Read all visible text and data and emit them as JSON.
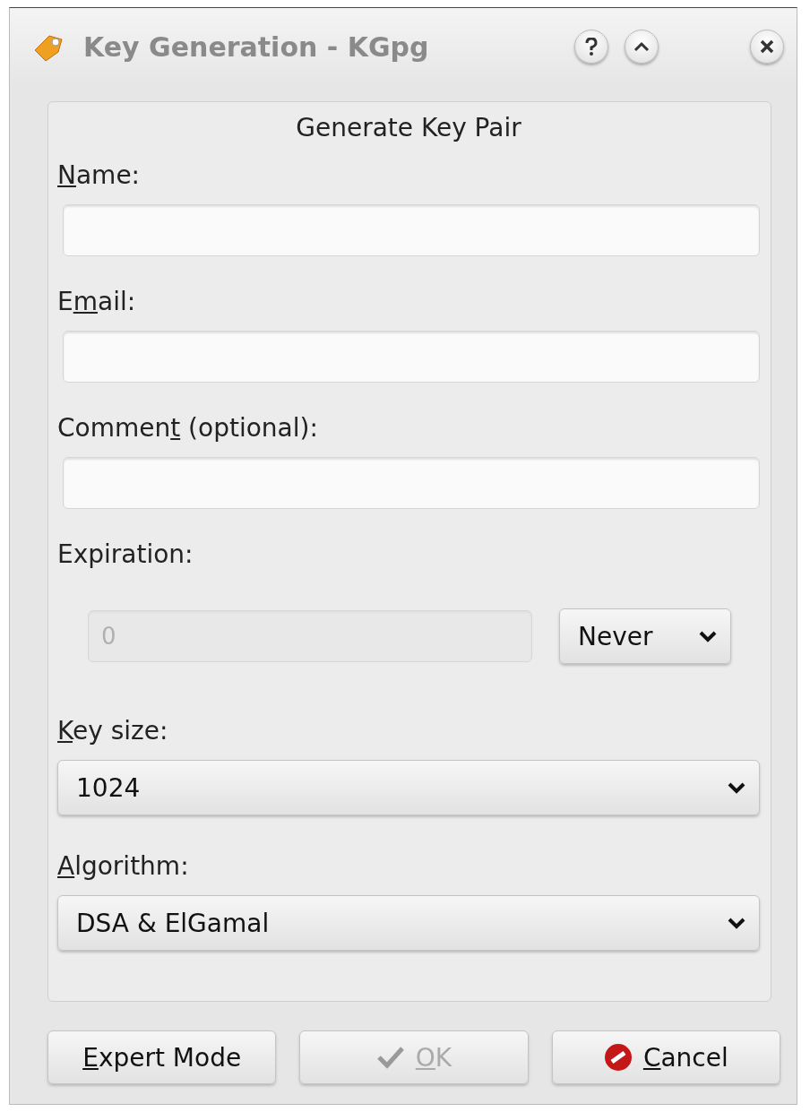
{
  "window": {
    "title": "Key Generation - KGpg"
  },
  "group": {
    "title": "Generate Key Pair"
  },
  "fields": [
    {
      "label": {
        "key": "N",
        "after": "ame:"
      }
    },
    {
      "label": {
        "before": "E",
        "key": "m",
        "after": "ail:"
      }
    },
    {
      "label": {
        "before": "Commen",
        "key": "t",
        "after": " (optional):"
      }
    }
  ],
  "expiration": {
    "label": {
      "before": "Expiration:"
    },
    "field": {
      "value": "0",
      "disabled": true
    },
    "combo": {
      "value": "Never"
    }
  },
  "combos": [
    {
      "label": {
        "key": "K",
        "after": "ey size:"
      },
      "value": "1024"
    },
    {
      "label": {
        "key": "A",
        "after": "lgorithm:"
      },
      "value": "DSA & ElGamal"
    }
  ],
  "buttons": [
    {
      "label": {
        "key": "E",
        "after": "xpert Mode"
      },
      "kind": "plain",
      "disabled": false
    },
    {
      "label": {
        "key": "O",
        "after": "K"
      },
      "kind": "accept",
      "disabled": true
    },
    {
      "label": {
        "key": "C",
        "after": "ancel"
      },
      "kind": "reject",
      "disabled": false
    }
  ]
}
